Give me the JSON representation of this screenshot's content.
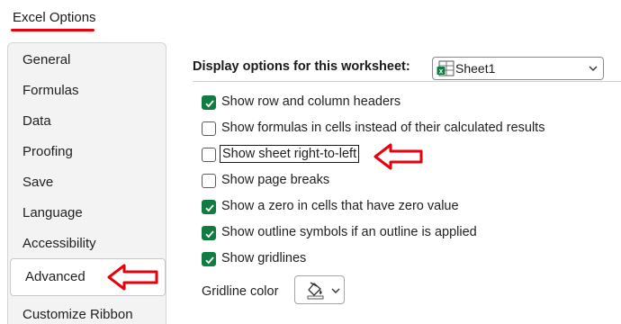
{
  "window": {
    "title": "Excel Options"
  },
  "sidebar": {
    "items": [
      {
        "label": "General",
        "active": false
      },
      {
        "label": "Formulas",
        "active": false
      },
      {
        "label": "Data",
        "active": false
      },
      {
        "label": "Proofing",
        "active": false
      },
      {
        "label": "Save",
        "active": false
      },
      {
        "label": "Language",
        "active": false
      },
      {
        "label": "Accessibility",
        "active": false
      },
      {
        "label": "Advanced",
        "active": true
      },
      {
        "label": "Customize Ribbon",
        "active": false
      }
    ]
  },
  "worksheet_section": {
    "header": "Display options for this worksheet:",
    "sheet_select": {
      "value": "Sheet1",
      "icon": "excel-sheet-icon"
    },
    "options": [
      {
        "label": "Show row and column headers",
        "checked": true
      },
      {
        "label": "Show formulas in cells instead of their calculated results",
        "checked": false
      },
      {
        "label": "Show sheet right-to-left",
        "checked": false,
        "highlighted": true
      },
      {
        "label": "Show page breaks",
        "checked": false
      },
      {
        "label": "Show a zero in cells that have zero value",
        "checked": true
      },
      {
        "label": "Show outline symbols if an outline is applied",
        "checked": true
      },
      {
        "label": "Show gridlines",
        "checked": true
      }
    ],
    "gridline_color": {
      "label": "Gridline color",
      "icon": "paint-bucket-icon"
    }
  },
  "colors": {
    "accent_green": "#107c41",
    "annotation_red": "#e8000b"
  }
}
